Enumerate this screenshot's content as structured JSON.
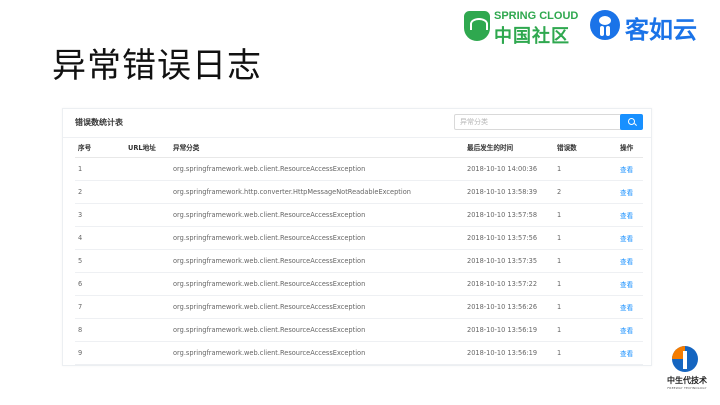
{
  "slide": {
    "title": "异常错误日志"
  },
  "logos": {
    "spring_cloud": {
      "top_text": "SPRING CLOUD",
      "bottom_text": "中国社区"
    },
    "kerugun": {
      "text": "客如云"
    },
    "zhongshengdai": {
      "text": "中生代技术",
      "subtext": "FREEWAY TECHNOLOGY"
    }
  },
  "panel": {
    "title": "错误数统计表",
    "search": {
      "placeholder": "异常分类",
      "value": ""
    },
    "columns": [
      "序号",
      "URL地址",
      "异常分类",
      "最后发生的时间",
      "错误数",
      "操作"
    ],
    "rows": [
      {
        "index": "1",
        "url": "",
        "category": "org.springframework.web.client.ResourceAccessException",
        "last_time": "2018-10-10 14:00:36",
        "count": "1",
        "action": "查看"
      },
      {
        "index": "2",
        "url": "",
        "category": "org.springframework.http.converter.HttpMessageNotReadableException",
        "last_time": "2018-10-10 13:58:39",
        "count": "2",
        "action": "查看"
      },
      {
        "index": "3",
        "url": "",
        "category": "org.springframework.web.client.ResourceAccessException",
        "last_time": "2018-10-10 13:57:58",
        "count": "1",
        "action": "查看"
      },
      {
        "index": "4",
        "url": "",
        "category": "org.springframework.web.client.ResourceAccessException",
        "last_time": "2018-10-10 13:57:56",
        "count": "1",
        "action": "查看"
      },
      {
        "index": "5",
        "url": "",
        "category": "org.springframework.web.client.ResourceAccessException",
        "last_time": "2018-10-10 13:57:35",
        "count": "1",
        "action": "查看"
      },
      {
        "index": "6",
        "url": "",
        "category": "org.springframework.web.client.ResourceAccessException",
        "last_time": "2018-10-10 13:57:22",
        "count": "1",
        "action": "查看"
      },
      {
        "index": "7",
        "url": "",
        "category": "org.springframework.web.client.ResourceAccessException",
        "last_time": "2018-10-10 13:56:26",
        "count": "1",
        "action": "查看"
      },
      {
        "index": "8",
        "url": "",
        "category": "org.springframework.web.client.ResourceAccessException",
        "last_time": "2018-10-10 13:56:19",
        "count": "1",
        "action": "查看"
      },
      {
        "index": "9",
        "url": "",
        "category": "org.springframework.web.client.ResourceAccessException",
        "last_time": "2018-10-10 13:56:19",
        "count": "1",
        "action": "查看"
      }
    ]
  },
  "colors": {
    "accent": "#1890ff",
    "spring_green": "#2fa84f",
    "kerugun_blue": "#1a73e8"
  },
  "icons": {
    "search_button": "search-icon"
  }
}
